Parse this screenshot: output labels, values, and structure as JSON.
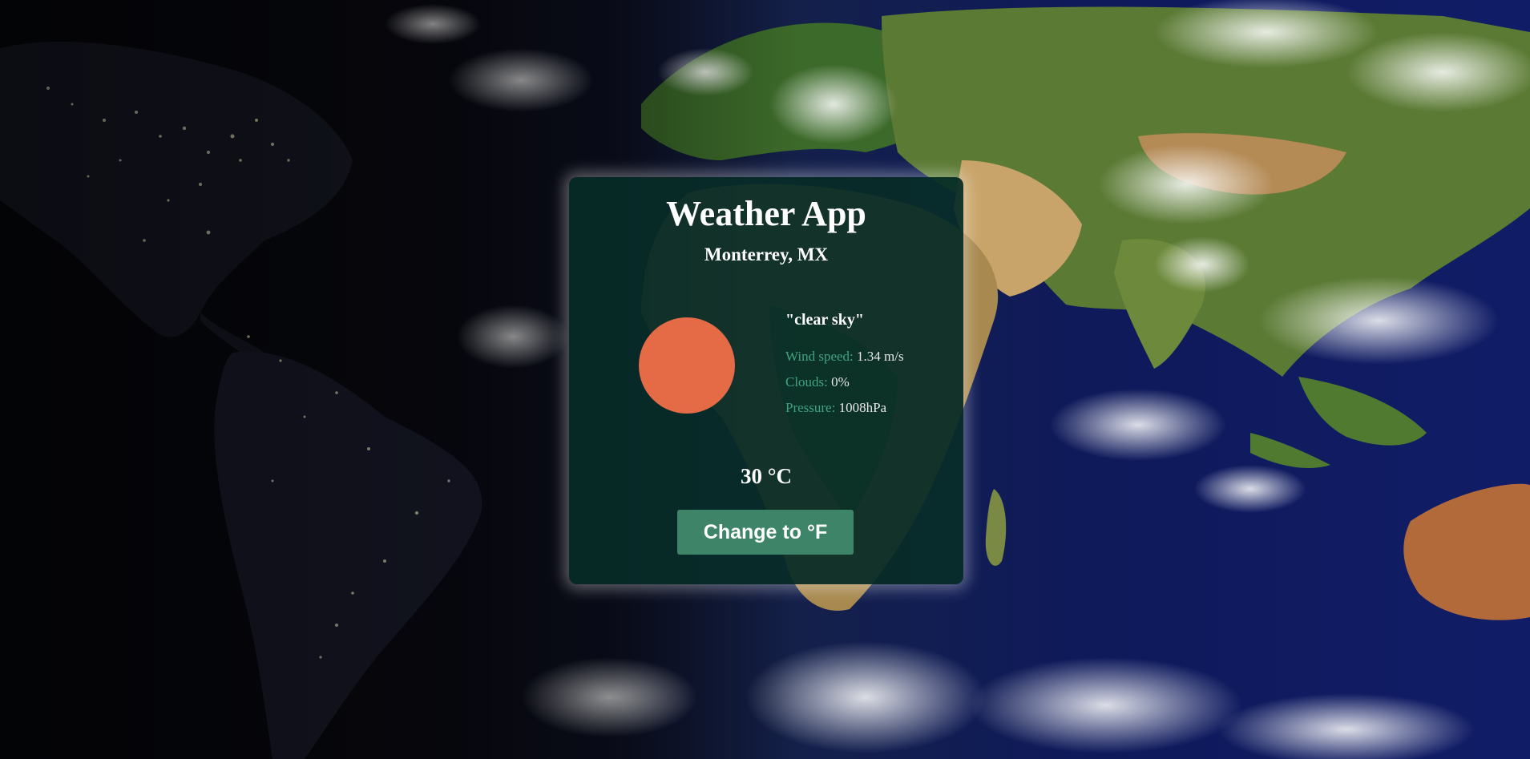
{
  "app": {
    "title": "Weather App",
    "location": "Monterrey, MX"
  },
  "weather": {
    "icon": "sun-icon",
    "description": "\"clear sky\"",
    "details": [
      {
        "label": "Wind speed: ",
        "value": "1.34 m/s"
      },
      {
        "label": "Clouds: ",
        "value": "0%"
      },
      {
        "label": "Pressure: ",
        "value": "1008hPa"
      }
    ],
    "temperature": "30 °C"
  },
  "controls": {
    "toggle_unit_label": "Change to °F"
  },
  "colors": {
    "card_background": "#082c28",
    "sun": "#e56b47",
    "detail_label": "#3fa37f",
    "button": "#3e8468"
  }
}
